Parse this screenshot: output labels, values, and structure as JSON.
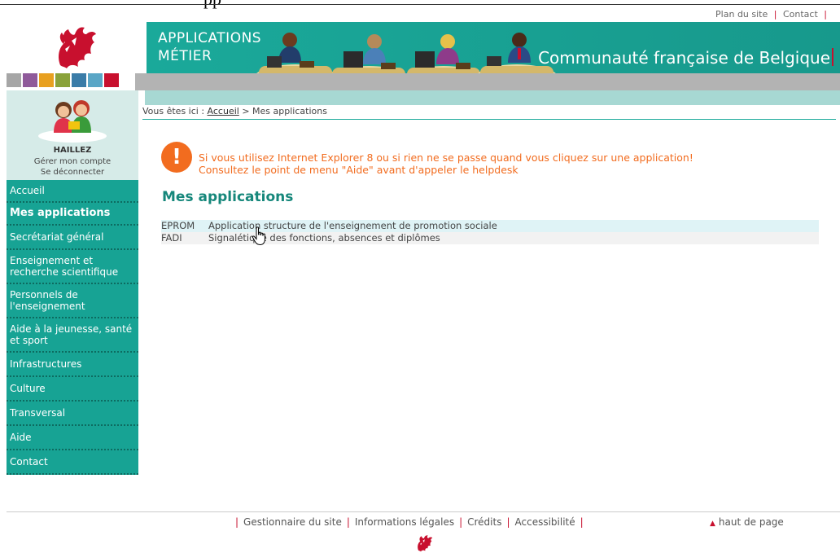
{
  "top": {
    "title_partial": "pp",
    "links": [
      "Plan du site",
      "Contact"
    ]
  },
  "banner": {
    "app_title_line1": "APPLICATIONS",
    "app_title_line2": "MÉTIER",
    "community": "Communauté française de Belgique"
  },
  "colors": {
    "brand_teal": "#1aa99a",
    "sidebar_teal": "#17a394",
    "warning_orange": "#f26c1f",
    "accent_red": "#c8102e",
    "color_bar": [
      "#a6a6a6",
      "#8f5a9a",
      "#e8a020",
      "#8aa23a",
      "#3a7ca8",
      "#5aa6c6",
      "#c8102e"
    ]
  },
  "user": {
    "name": "HAILLEZ",
    "manage": "Gérer mon compte",
    "logout": "Se déconnecter"
  },
  "nav": [
    {
      "label": "Accueil",
      "active": false
    },
    {
      "label": "Mes applications",
      "active": true
    },
    {
      "label": "Secrétariat général",
      "active": false
    },
    {
      "label": "Enseignement et recherche scientifique",
      "active": false
    },
    {
      "label": "Personnels de l'enseignement",
      "active": false
    },
    {
      "label": "Aide à la jeunesse, santé et sport",
      "active": false
    },
    {
      "label": "Infrastructures",
      "active": false
    },
    {
      "label": "Culture",
      "active": false
    },
    {
      "label": "Transversal",
      "active": false
    },
    {
      "label": "Aide",
      "active": false
    },
    {
      "label": "Contact",
      "active": false
    }
  ],
  "breadcrumb": {
    "prefix": "Vous êtes ici : ",
    "home": "Accueil",
    "separator": " > ",
    "current": "Mes applications"
  },
  "warning": {
    "icon": "!",
    "line1": "Si vous utilisez Internet Explorer 8 ou si rien ne se passe quand vous cliquez sur une application!",
    "line2": "Consultez le point de menu \"Aide\" avant d'appeler le helpdesk"
  },
  "main": {
    "heading": "Mes applications",
    "apps": [
      {
        "code": "EPROM",
        "description": "Application structure de l'enseignement de promotion sociale"
      },
      {
        "code": "FADI",
        "description": "Signalétique des fonctions, absences et diplômes"
      }
    ]
  },
  "footer": {
    "links": [
      "Gestionnaire du site",
      "Informations légales",
      "Crédits",
      "Accessibilité"
    ],
    "top_of_page": "haut de page"
  }
}
